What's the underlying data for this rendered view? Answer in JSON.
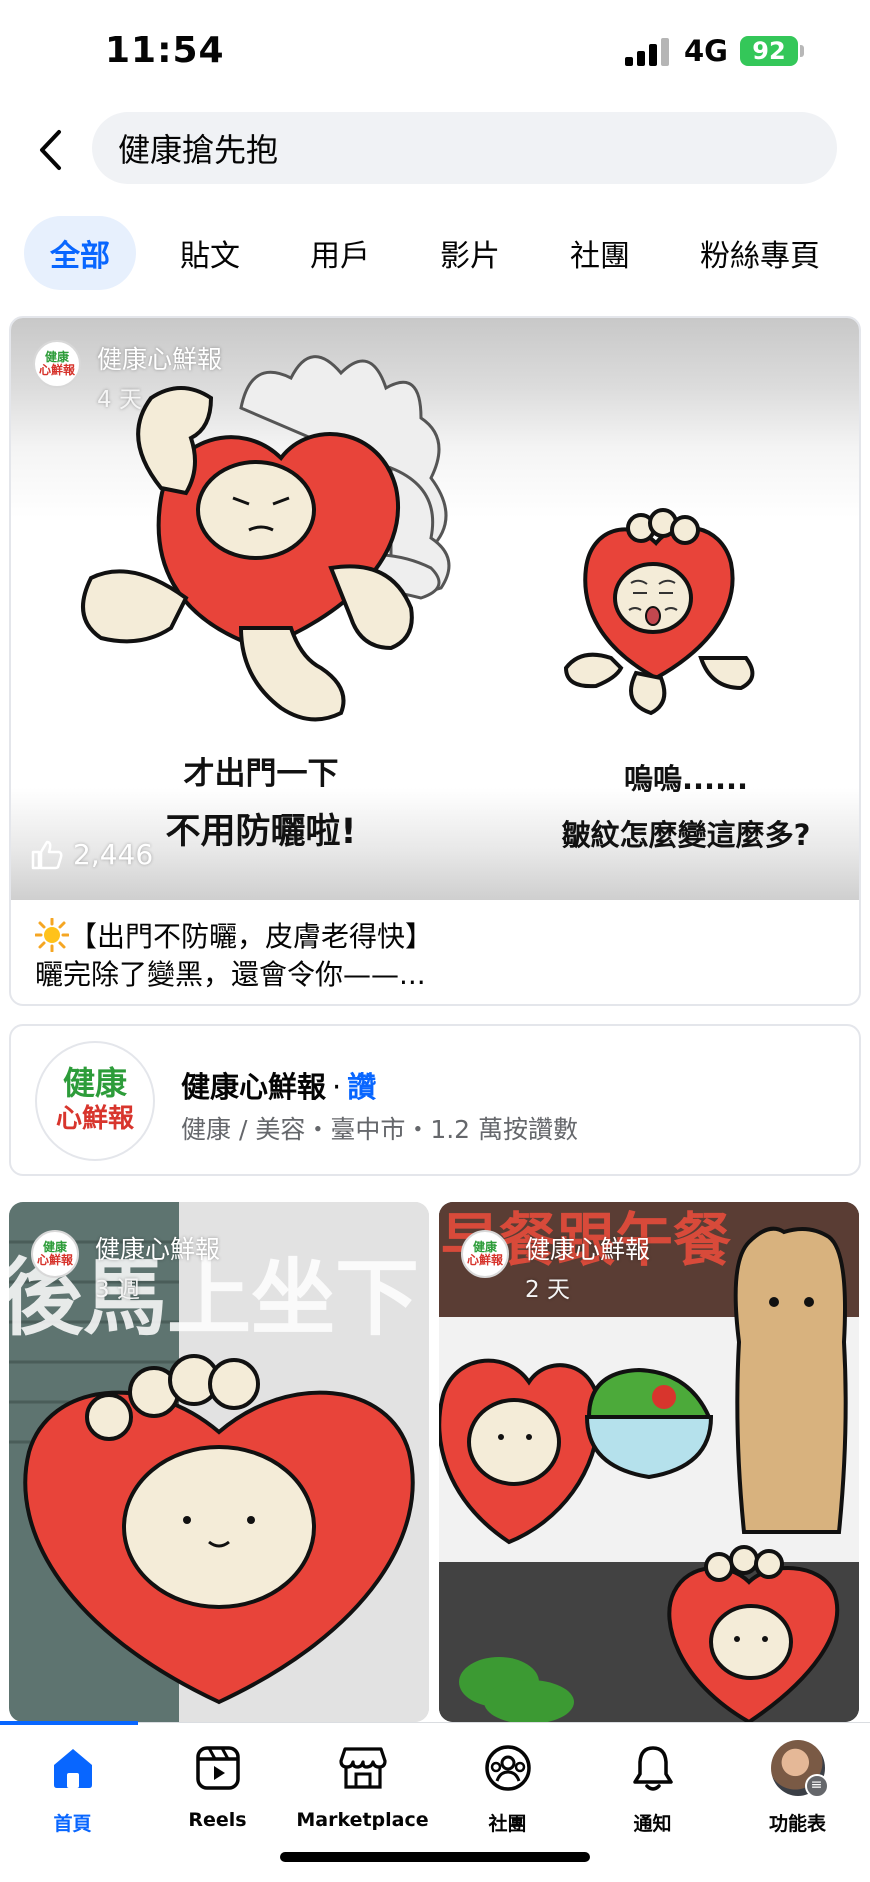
{
  "status_bar": {
    "time": "11:54",
    "network": "4G",
    "battery": "92"
  },
  "search": {
    "query": "健康搶先抱"
  },
  "tabs": [
    {
      "label": "全部",
      "active": true
    },
    {
      "label": "貼文",
      "active": false
    },
    {
      "label": "用戶",
      "active": false
    },
    {
      "label": "影片",
      "active": false
    },
    {
      "label": "社團",
      "active": false
    },
    {
      "label": "粉絲專頁",
      "active": false
    }
  ],
  "main_post": {
    "author": "健康心鮮報",
    "time": "4 天",
    "avatar_text_1": "健康",
    "avatar_text_2": "心鮮報",
    "image_caption_left_1": "才出門一下",
    "image_caption_left_2": "不用防曬啦!",
    "image_caption_right_1": "嗚嗚......",
    "image_caption_right_2": "皺紋怎麼變這麼多?",
    "likes": "2,446",
    "text_line_1": "【出門不防曬，皮膚老得快】",
    "text_line_2": "曬完除了變黑，還會令你——..."
  },
  "page_result": {
    "name": "健康心鮮報",
    "separator": "·",
    "like_label": "讚",
    "meta": "健康 / 美容・臺中市・1.2 萬按讚數",
    "avatar_text_1": "健康",
    "avatar_text_2": "心鮮報"
  },
  "grid_posts": [
    {
      "author": "健康心鮮報",
      "time": "3 週",
      "banner": "後馬上坐下"
    },
    {
      "author": "健康心鮮報",
      "time": "2 天",
      "banner": "早餐跟午餐"
    }
  ],
  "bottom_nav": [
    {
      "label": "首頁",
      "icon": "home-icon",
      "active": true
    },
    {
      "label": "Reels",
      "icon": "reels-icon",
      "active": false
    },
    {
      "label": "Marketplace",
      "icon": "marketplace-icon",
      "active": false
    },
    {
      "label": "社團",
      "icon": "groups-icon",
      "active": false
    },
    {
      "label": "通知",
      "icon": "bell-icon",
      "active": false
    },
    {
      "label": "功能表",
      "icon": "menu-avatar",
      "active": false
    }
  ],
  "colors": {
    "accent": "#0866ff",
    "heart_red": "#e8443a",
    "battery_green": "#34c759"
  }
}
